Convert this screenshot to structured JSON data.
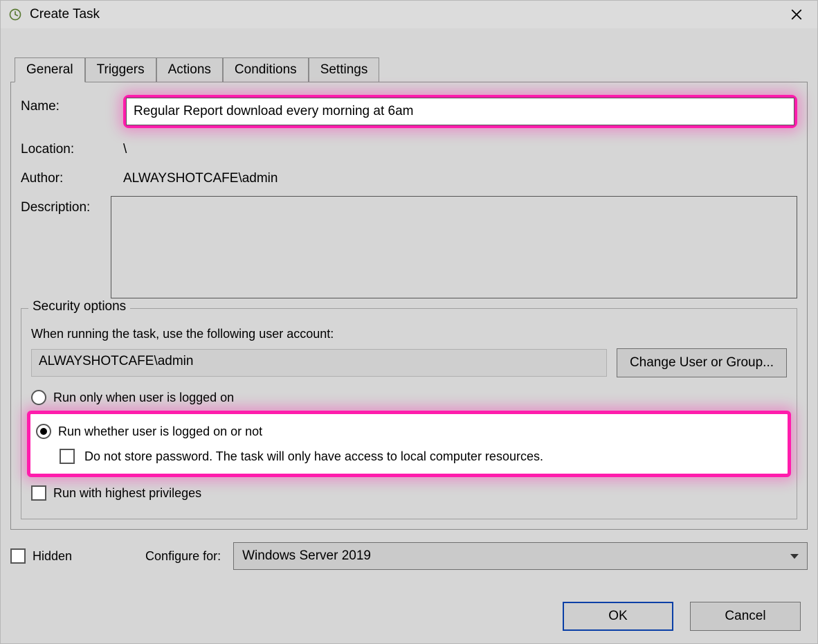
{
  "window": {
    "title": "Create Task"
  },
  "tabs": [
    "General",
    "Triggers",
    "Actions",
    "Conditions",
    "Settings"
  ],
  "general": {
    "name_label": "Name:",
    "name_value": "Regular Report download every morning at 6am",
    "location_label": "Location:",
    "location_value": "\\",
    "author_label": "Author:",
    "author_value": "ALWAYSHOTCAFE\\admin",
    "description_label": "Description:",
    "description_value": ""
  },
  "security": {
    "legend": "Security options",
    "when_running_label": "When running the task, use the following user account:",
    "user_account": "ALWAYSHOTCAFE\\admin",
    "change_user_btn": "Change User or Group...",
    "radio_logged_on": "Run only when user is logged on",
    "radio_logged_or_not": "Run whether user is logged on or not",
    "radio_selected": "logged_or_not",
    "no_store_password": "Do not store password.  The task will only have access to local computer resources.",
    "highest_privileges": "Run with highest privileges"
  },
  "footer": {
    "hidden_label": "Hidden",
    "configure_for_label": "Configure for:",
    "configure_for_value": "Windows Server 2019"
  },
  "buttons": {
    "ok": "OK",
    "cancel": "Cancel"
  }
}
